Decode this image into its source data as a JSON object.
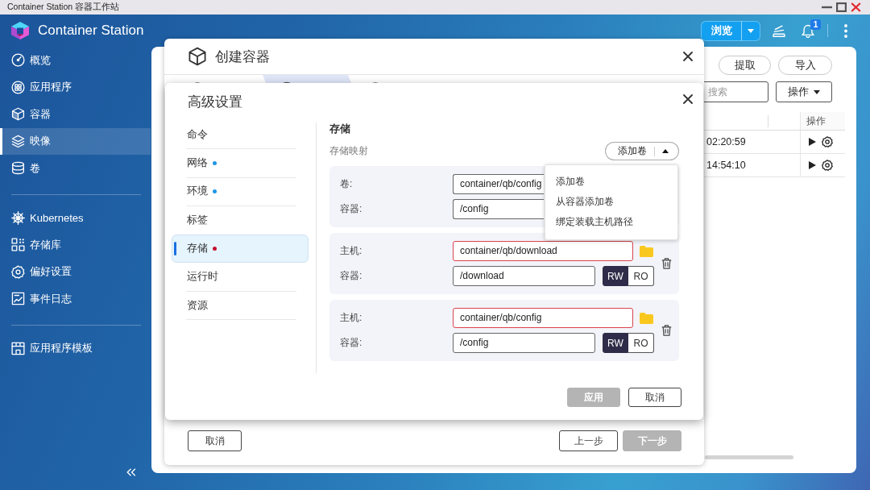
{
  "window": {
    "title": "Container Station 容器工作站"
  },
  "header": {
    "app_name": "Container Station",
    "browse_button": {
      "label": "浏览"
    },
    "notifications": {
      "count": "1"
    }
  },
  "sidebar": {
    "groups": [
      {
        "items": [
          {
            "label": "概览",
            "selected": false
          },
          {
            "label": "应用程序",
            "selected": false
          },
          {
            "label": "容器",
            "selected": false
          },
          {
            "label": "映像",
            "selected": true
          },
          {
            "label": "卷",
            "selected": false
          }
        ]
      },
      {
        "items": [
          {
            "label": "Kubernetes",
            "selected": false
          },
          {
            "label": "存储库",
            "selected": false
          },
          {
            "label": "偏好设置",
            "selected": false
          },
          {
            "label": "事件日志",
            "selected": false
          }
        ]
      },
      {
        "items": [
          {
            "label": "应用程序模板",
            "selected": false
          }
        ]
      }
    ]
  },
  "images_panel": {
    "buttons": [
      {
        "label": "提取"
      },
      {
        "label": "导入"
      }
    ],
    "search": {
      "placeholder": "搜索"
    },
    "action_button": {
      "label": "操作"
    },
    "table": {
      "action_column": "操作",
      "rows": [
        {
          "column_1": "02:20:59"
        },
        {
          "column_1": "14:54:10"
        }
      ]
    }
  },
  "create_dialog": {
    "title": "创建容器",
    "steps": [
      {
        "selected": false
      },
      {
        "selected": true
      },
      {
        "selected": false
      }
    ],
    "footer_left": [
      {
        "label": "取消",
        "disabled": false
      }
    ],
    "footer_right": [
      {
        "label": "上一步",
        "disabled": false
      },
      {
        "label": "下一步",
        "disabled": true
      }
    ]
  },
  "advanced_dialog": {
    "title": "高级设置",
    "nav": [
      {
        "label": "命令",
        "selected": false
      },
      {
        "label": "网络",
        "selected": false,
        "color": "#1e96e6"
      },
      {
        "label": "环境",
        "selected": false,
        "color": "#1e96e6"
      },
      {
        "label": "标签",
        "selected": false
      },
      {
        "label": "存储",
        "selected": true,
        "color": "#c8102e"
      },
      {
        "label": "运行时",
        "selected": false
      },
      {
        "label": "资源",
        "selected": false
      }
    ],
    "section": {
      "title": "存储",
      "subtitle": "存储映射"
    },
    "add_volume": {
      "label": "添加卷",
      "expanded": true,
      "menu": [
        {
          "label": "添加卷"
        },
        {
          "label": "从容器添加卷"
        },
        {
          "label": "绑定装载主机路径"
        }
      ]
    },
    "mappings": [
      {
        "kind": "volume",
        "source": {
          "label": "卷:",
          "value": "container/qb/config",
          "error": false
        },
        "target": {
          "label": "容器:",
          "value": "/config"
        }
      },
      {
        "kind": "host",
        "source": {
          "label": "主机:",
          "value": "container/qb/download",
          "error": true
        },
        "target": {
          "label": "容器:",
          "value": "/download"
        },
        "access": [
          {
            "label": "RW",
            "selected": true
          },
          {
            "label": "RO",
            "selected": false
          }
        ]
      },
      {
        "kind": "host",
        "source": {
          "label": "主机:",
          "value": "container/qb/config",
          "error": true
        },
        "target": {
          "label": "容器:",
          "value": "/config"
        },
        "access": [
          {
            "label": "RW",
            "selected": true
          },
          {
            "label": "RO",
            "selected": false
          }
        ]
      }
    ],
    "footer": [
      {
        "label": "应用",
        "disabled": true
      },
      {
        "label": "取消",
        "disabled": false
      }
    ]
  }
}
